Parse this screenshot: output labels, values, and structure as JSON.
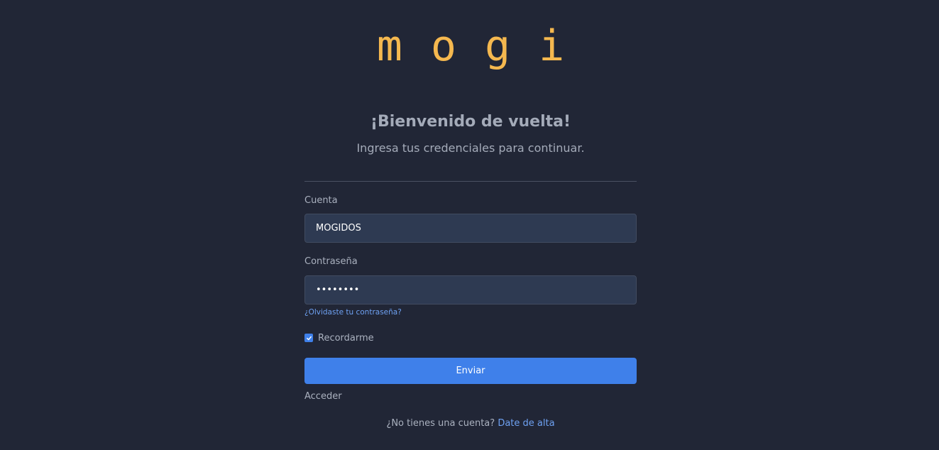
{
  "brand": {
    "logo_text": "mogi",
    "color": "#f5b84f"
  },
  "header": {
    "title": "¡Bienvenido de vuelta!",
    "subtitle": "Ingresa tus credenciales para continuar."
  },
  "form": {
    "account_label": "Cuenta",
    "account_value": "MOGIDOS",
    "password_label": "Contraseña",
    "password_value": "••••••••",
    "forgot_link": "¿Olvidaste tu contraseña?",
    "remember_label": "Recordarme",
    "remember_checked": true,
    "submit_label": "Enviar",
    "access_text": "Acceder"
  },
  "footer": {
    "prompt": "¿No tienes una cuenta?",
    "signup_link": "Date de alta"
  },
  "colors": {
    "background": "#212636",
    "input_background": "#2e3a52",
    "accent": "#3f80ea",
    "link": "#6ea1f2"
  }
}
